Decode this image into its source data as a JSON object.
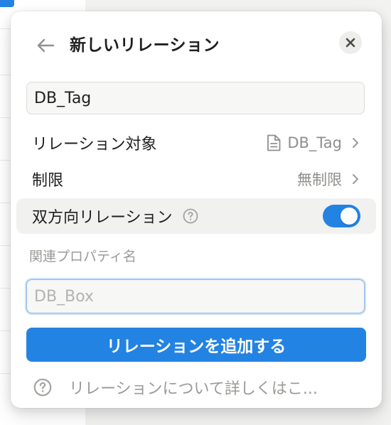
{
  "panel": {
    "title": "新しいリレーション",
    "name_value": "DB_Tag"
  },
  "rows": {
    "relation_target": {
      "label": "リレーション対象",
      "value": "DB_Tag"
    },
    "limit": {
      "label": "制限",
      "value": "無制限"
    },
    "bidirectional": {
      "label": "双方向リレーション",
      "enabled": true
    }
  },
  "related_property": {
    "label": "関連プロパティ名",
    "placeholder": "DB_Box"
  },
  "add_button": {
    "label": "リレーションを追加する"
  },
  "learn_more": {
    "label": "リレーションについて詳しくはこ..."
  },
  "icons": {
    "back": "arrow-left-icon",
    "close": "close-icon",
    "page": "page-icon",
    "chevron": "chevron-right-icon",
    "help": "help-icon"
  },
  "colors": {
    "accent": "#2383e2",
    "muted_text": "#9b9a97",
    "toggle_on": "#2383e2"
  }
}
